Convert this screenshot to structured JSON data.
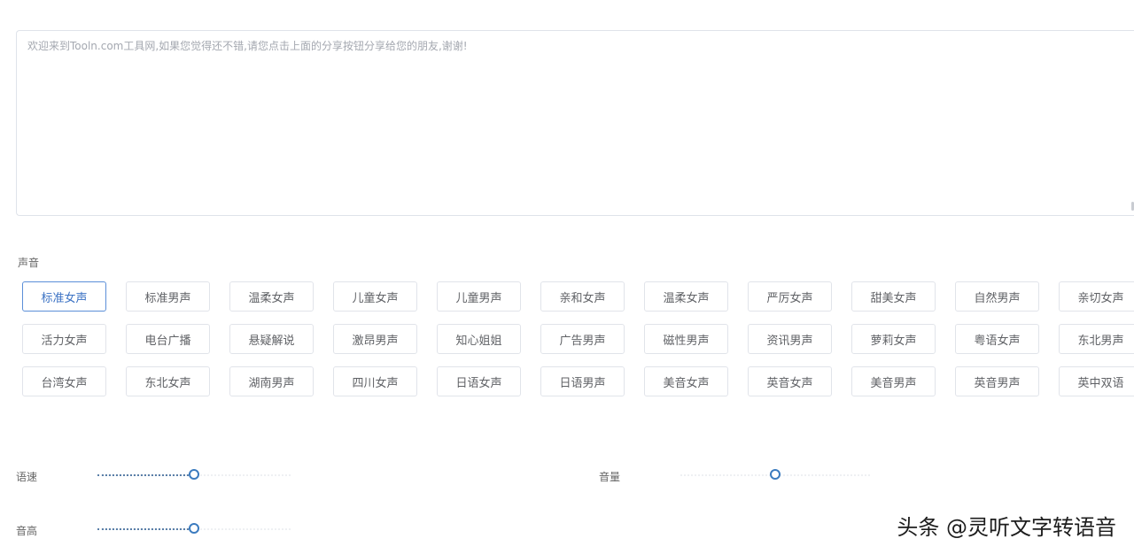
{
  "editor": {
    "text": "欢迎来到Tooln.com工具网,如果您觉得还不错,请您点击上面的分享按钮分享给您的朋友,谢谢!"
  },
  "voice_section": {
    "label": "声音",
    "selected": "标准女声",
    "rows": [
      [
        "标准女声",
        "标准男声",
        "温柔女声",
        "儿童女声",
        "儿童男声",
        "亲和女声",
        "温柔女声",
        "严厉女声",
        "甜美女声",
        "自然男声",
        "亲切女声"
      ],
      [
        "活力女声",
        "电台广播",
        "悬疑解说",
        "激昂男声",
        "知心姐姐",
        "广告男声",
        "磁性男声",
        "资讯男声",
        "萝莉女声",
        "粤语女声",
        "东北男声"
      ],
      [
        "台湾女声",
        "东北女声",
        "湖南男声",
        "四川女声",
        "日语女声",
        "日语男声",
        "美音女声",
        "英音女声",
        "美音男声",
        "英音男声",
        "英中双语"
      ]
    ]
  },
  "sliders": {
    "speed": {
      "label": "语速",
      "value": 0.5
    },
    "volume": {
      "label": "音量",
      "value": 0.5
    },
    "pitch": {
      "label": "音高",
      "value": 0.5
    }
  },
  "watermark": "头条 @灵听文字转语音",
  "colors": {
    "selected_border": "#5b8fd8",
    "slider_handle": "#3b7bbf",
    "border": "#e1e4ea"
  }
}
